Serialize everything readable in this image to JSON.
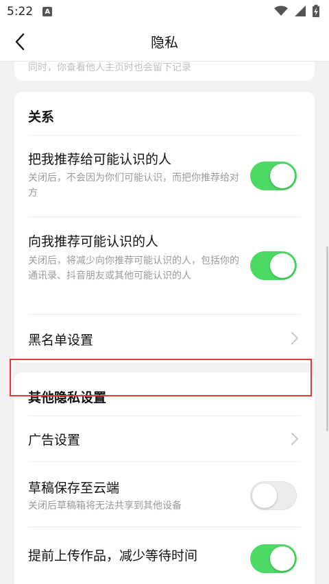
{
  "status": {
    "time": "5:22",
    "badge": "A"
  },
  "nav": {
    "title": "隐私"
  },
  "previous_card": {
    "text": "同时，你查看他人主页时也会留下记录"
  },
  "relations": {
    "title": "关系",
    "recommend_me": {
      "title": "把我推荐给可能认识的人",
      "desc": "关闭后，不会因为你们可能认识，而把你推荐给对方",
      "enabled": true
    },
    "recommend_to_me": {
      "title": "向我推荐可能认识的人",
      "desc": "关闭后，将减少向你推荐可能认识的人，包括你的通讯录、抖音朋友或其他可能认识的人",
      "enabled": true
    },
    "blacklist": {
      "title": "黑名单设置"
    }
  },
  "other_privacy": {
    "title": "其他隐私设置",
    "ad_settings": {
      "title": "广告设置"
    },
    "draft_cloud": {
      "title": "草稿保存至云端",
      "desc": "关闭后草稿箱将无法共享到其他设备",
      "enabled": false
    },
    "preupload": {
      "title": "提前上传作品，减少等待时间",
      "enabled": true
    }
  },
  "colors": {
    "toggle_on": "#4cd964",
    "highlight": "#e53935",
    "background": "#f2f2f5"
  }
}
